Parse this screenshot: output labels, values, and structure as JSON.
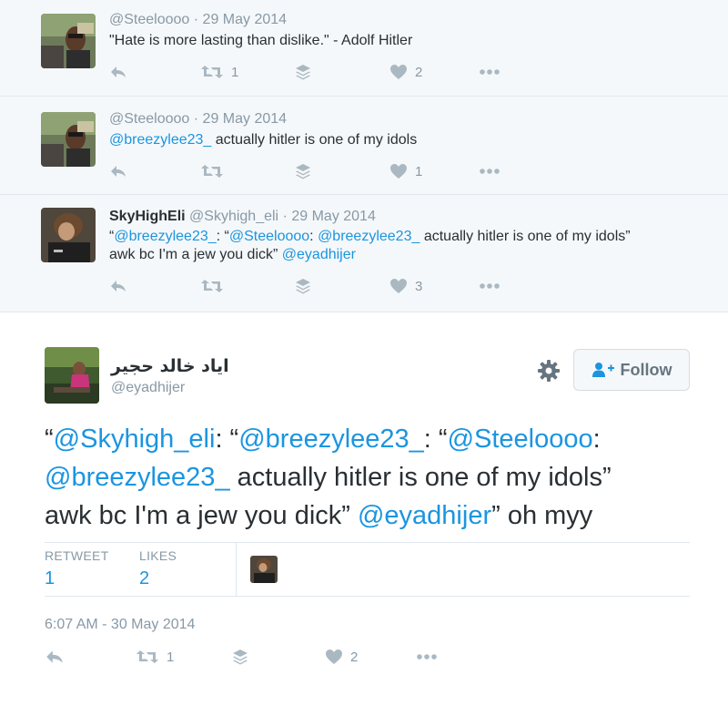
{
  "replies": [
    {
      "username": "@Steeloooo",
      "date": "29 May 2014",
      "text": "\"Hate is more lasting than dislike.\" - Adolf Hitler",
      "retweet_count": "1",
      "like_count": "2"
    },
    {
      "username": "@Steeloooo",
      "date": "29 May 2014",
      "text_mention": "@breezylee23_",
      "text_rest": " actually hitler is one of my idols",
      "like_count": "1"
    },
    {
      "fullname": "SkyHighEli",
      "username": "@Skyhigh_eli",
      "date": "29 May 2014",
      "line1_a": "“",
      "line1_m1": "@breezylee23_",
      "line1_b": ": “",
      "line1_m2": "@Steeloooo",
      "line1_c": ": ",
      "line1_m3": "@breezylee23_",
      "line1_d": " actually hitler is one of my idols”",
      "line2_a": "awk bc I'm a jew you dick” ",
      "line2_m": "@eyadhijer",
      "like_count": "3"
    }
  ],
  "main_tweet": {
    "fullname": "اياد خالد حجير",
    "username": "@eyadhijer",
    "follow_label": "Follow",
    "t1": "“",
    "m1": "@Skyhigh_eli",
    "t2": ": “",
    "m2": "@breezylee23_",
    "t3": ": “",
    "m3": "@Steeloooo",
    "t4": ":",
    "m4": "@breezylee23_",
    "t5": " actually hitler is one of my idols”",
    "t6": "awk bc I'm a jew you dick” ",
    "m5": "@eyadhijer",
    "t7": "” oh myy",
    "retweet_label": "RETWEET",
    "retweet_count": "1",
    "likes_label": "LIKES",
    "likes_count": "2",
    "timestamp": "6:07 AM - 30 May 2014",
    "action_retweet_count": "1",
    "action_like_count": "2"
  },
  "colors": {
    "link": "#1b95e0",
    "muted": "#8899a6",
    "icon": "#aab8c2",
    "reply_bg": "#f5f8fa"
  }
}
